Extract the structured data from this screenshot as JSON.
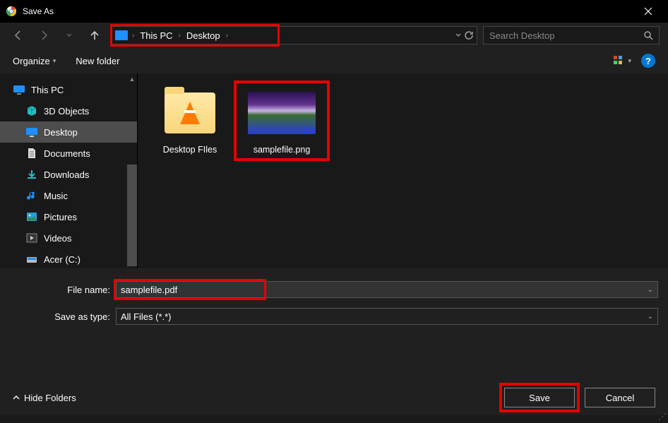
{
  "window": {
    "title": "Save As"
  },
  "breadcrumb": {
    "items": [
      "This PC",
      "Desktop"
    ]
  },
  "search": {
    "placeholder": "Search Desktop"
  },
  "toolbar": {
    "organize": "Organize",
    "newfolder": "New folder"
  },
  "sidebar": {
    "root": "This PC",
    "items": [
      "3D Objects",
      "Desktop",
      "Documents",
      "Downloads",
      "Music",
      "Pictures",
      "Videos",
      "Acer (C:)"
    ],
    "selectedIndex": 1
  },
  "content": {
    "items": [
      {
        "label": "Desktop FIles",
        "kind": "folder"
      },
      {
        "label": "samplefile.png",
        "kind": "image",
        "highlighted": true
      }
    ]
  },
  "form": {
    "filenameLabel": "File name:",
    "filenameValue": "samplefile.pdf",
    "typeLabel": "Save as type:",
    "typeValue": "All Files (*.*)"
  },
  "footer": {
    "hide": "Hide Folders",
    "save": "Save",
    "cancel": "Cancel"
  }
}
